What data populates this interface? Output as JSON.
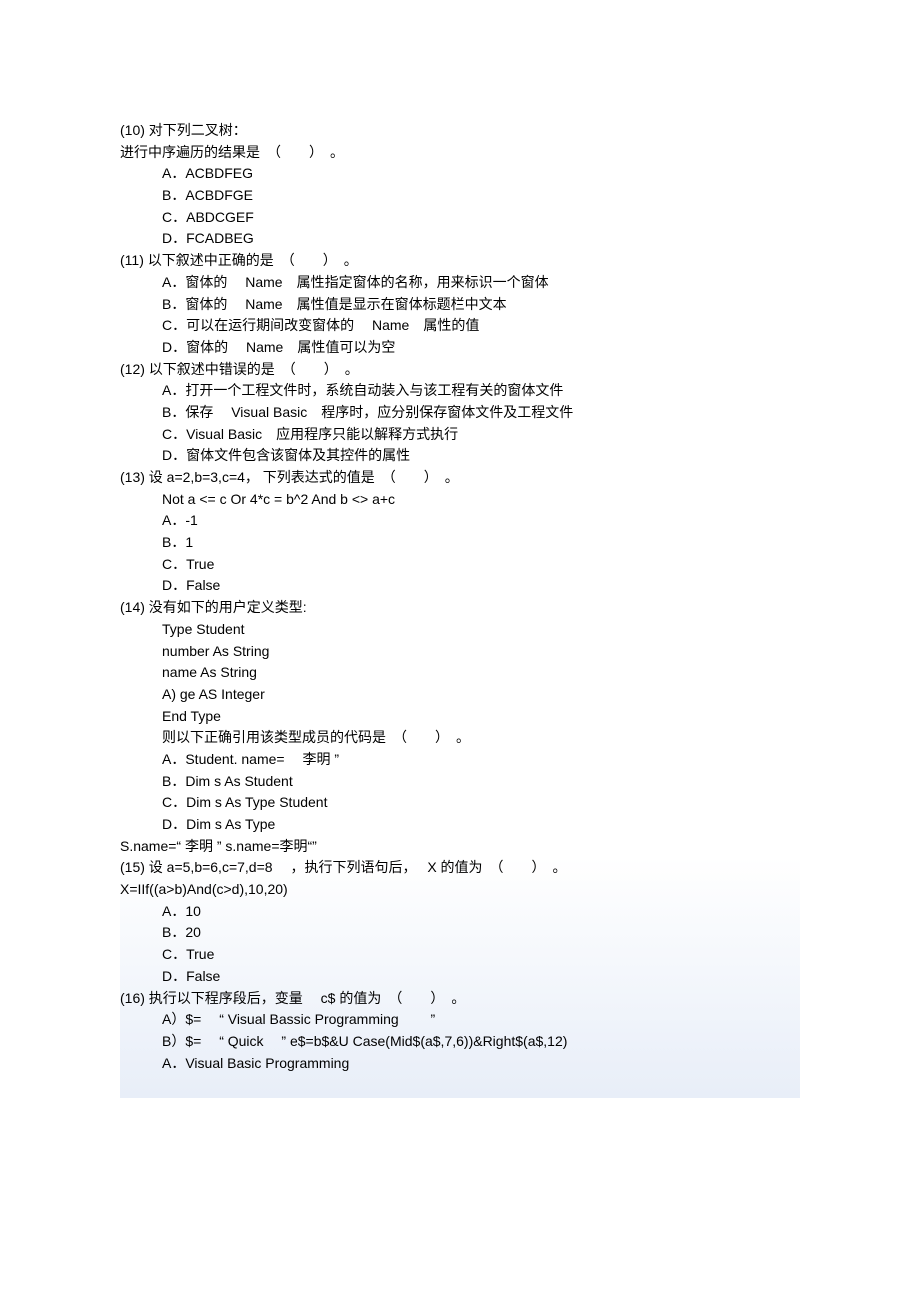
{
  "q10": {
    "stem1": "(10) 对下列二叉树：",
    "stem2": "进行中序遍历的结果是　（　　）　。",
    "a": "A．ACBDFEG",
    "b": "B．ACBDFGE",
    "c": "C．ABDCGEF",
    "d": "D．FCADBEG"
  },
  "q11": {
    "stem": "(11) 以下叙述中正确的是　（　　）　。",
    "a": "A．窗体的　 Name　属性指定窗体的名称，用来标识一个窗体",
    "b": "B．窗体的　 Name　属性值是显示在窗体标题栏中文本",
    "c": "C．可以在运行期间改变窗体的　 Name　属性的值",
    "d": "D．窗体的　 Name　属性值可以为空"
  },
  "q12": {
    "stem": "(12) 以下叙述中错误的是　（　　）　。",
    "a": "A．打开一个工程文件时，系统自动装入与该工程有关的窗体文件",
    "b": "B．保存　 Visual Basic　程序时，应分别保存窗体文件及工程文件",
    "c": "C．Visual Basic　应用程序只能以解释方式执行",
    "d": "D．窗体文件包含该窗体及其控件的属性"
  },
  "q13": {
    "stem": "(13) 设  a=2,b=3,c=4， 下列表达式的值是　（　　）　。",
    "expr": "Not a <= c Or 4*c = b^2 And b <> a+c",
    "a": "A．-1",
    "b": "B．1",
    "c": "C．True",
    "d": "D．False"
  },
  "q14": {
    "stem": "(14) 没有如下的用户定义类型:",
    "l1": "Type Student",
    "l2": "number As String",
    "l3": "name As String",
    "l4": "A) ge AS Integer",
    "l5": "End Type",
    "stem2": "则以下正确引用该类型成员的代码是　（　　）　。",
    "a": "A．Student. name=　 李明 ”",
    "b": "B．Dim s As Student",
    "c": "C．Dim s As Type Student",
    "d": "D．Dim s As Type",
    "tail": "S.name=“ 李明 ”  s.name=李明“”"
  },
  "q15": {
    "stem": "(15) 设  a=5,b=6,c=7,d=8　 ，执行下列语句后，　 X  的值为　（　　）　。",
    "expr": "X=IIf((a>b)And(c>d),10,20)",
    "a": "A．10",
    "b": "B．20",
    "c": "C．True",
    "d": "D．False"
  },
  "q16": {
    "stem": "(16) 执行以下程序段后，变量　 c$  的值为　（　　）　。",
    "l1": "A）$=　 “ Visual Bassic Programming　　 ”",
    "l2": "B）$=　 “ Quick　 ”  e$=b$&U Case(Mid$(a$,7,6))&Right$(a$,12)",
    "a": "A．Visual Basic Programming"
  }
}
